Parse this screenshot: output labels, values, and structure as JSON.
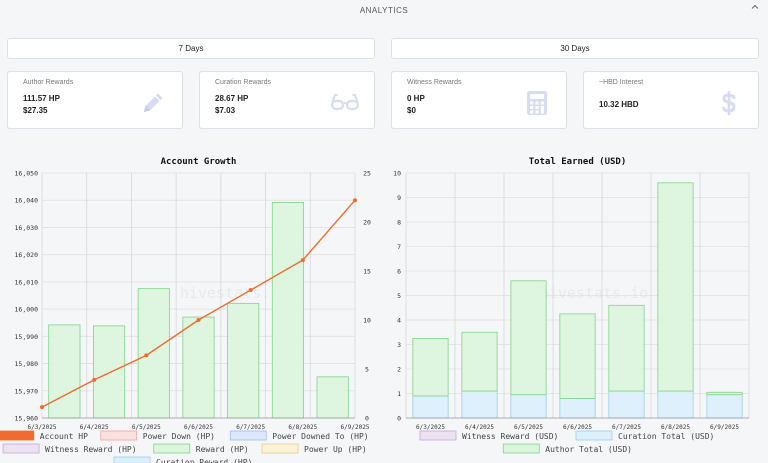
{
  "header": {
    "title": "ANALYTICS"
  },
  "range_buttons": [
    {
      "label": "7 Days"
    },
    {
      "label": "30 Days"
    }
  ],
  "cards": [
    {
      "label": "Author Rewards",
      "value_hp": "111.57 HP",
      "value_usd": "$27.35",
      "icon": "pencil-icon"
    },
    {
      "label": "Curation Rewards",
      "value_hp": "28.67 HP",
      "value_usd": "$7.03",
      "icon": "glasses-icon"
    },
    {
      "label": "Witness Rewards",
      "value_hp": "0 HP",
      "value_usd": "$0",
      "icon": "calculator-icon"
    },
    {
      "label": "~HBD Interest",
      "value_hp": "10.32 HBD",
      "value_usd": "",
      "icon": "dollar-icon"
    }
  ],
  "colors": {
    "accent_line": "#f26a2e",
    "reward_fill": "#dcf5dc",
    "reward_stroke": "#7fd38a",
    "curation_fill": "#dcf0fb",
    "card_icon": "#d8dcf0"
  },
  "watermark": "hivestats.io",
  "chart_data": [
    {
      "type": "bar",
      "title": "Account Growth",
      "categories": [
        "6/3/2025",
        "6/4/2025",
        "6/5/2025",
        "6/6/2025",
        "6/7/2025",
        "6/8/2025",
        "6/9/2025"
      ],
      "y_left": {
        "min": 15960,
        "max": 16050,
        "ticks": [
          "16,050",
          "16,040",
          "16,030",
          "16,020",
          "16,010",
          "16,000",
          "15,990",
          "15,980",
          "15,970",
          "15,960"
        ]
      },
      "y_right": {
        "min": 0,
        "max": 25,
        "ticks": [
          "25",
          "20",
          "15",
          "10",
          "5",
          "0"
        ]
      },
      "series": [
        {
          "name": "Account HP",
          "type": "line",
          "axis": "left",
          "values": [
            15964,
            15974,
            15983,
            15996,
            16007,
            16018,
            16040
          ]
        },
        {
          "name": "Power Down (HP)",
          "type": "bar",
          "axis": "right",
          "values": [
            0,
            0,
            0,
            0,
            0,
            0,
            0
          ]
        },
        {
          "name": "Power Downed To (HP)",
          "type": "bar",
          "axis": "right",
          "values": [
            0,
            0,
            0,
            0,
            0,
            0,
            0
          ]
        },
        {
          "name": "Witness Reward (HP)",
          "type": "bar",
          "axis": "right",
          "values": [
            0,
            0,
            0,
            0,
            0,
            0,
            0
          ]
        },
        {
          "name": "Reward (HP)",
          "type": "bar",
          "axis": "right",
          "values": [
            9.5,
            9.4,
            13.2,
            10.3,
            11.7,
            22.0,
            4.2
          ]
        },
        {
          "name": "Power Up (HP)",
          "type": "bar",
          "axis": "right",
          "values": [
            0,
            0,
            0,
            0,
            0,
            0,
            0
          ]
        },
        {
          "name": "Curation Reward (HP)",
          "type": "bar",
          "axis": "right",
          "values": [
            0,
            0,
            0,
            0,
            0,
            0,
            0
          ]
        }
      ],
      "legend": [
        {
          "name": "Account HP",
          "fill": "#f26a2e",
          "stroke": "#f26a2e"
        },
        {
          "name": "Power Down (HP)",
          "fill": "#fde0e0",
          "stroke": "#f4a0a0"
        },
        {
          "name": "Power Downed To (HP)",
          "fill": "#dbe8fb",
          "stroke": "#9dbcec"
        },
        {
          "name": "Witness Reward (HP)",
          "fill": "#ece2f2",
          "stroke": "#c3a8d6"
        },
        {
          "name": "Reward (HP)",
          "fill": "#dcf5dc",
          "stroke": "#7fd38a"
        },
        {
          "name": "Power Up (HP)",
          "fill": "#faf3d8",
          "stroke": "#e3cf8a"
        },
        {
          "name": "Curation Reward (HP)",
          "fill": "#dcf0fb",
          "stroke": "#9ccde8"
        }
      ],
      "grid": true,
      "legend_position": "bottom"
    },
    {
      "type": "bar",
      "stacked": true,
      "title": "Total Earned (USD)",
      "categories": [
        "6/3/2025",
        "6/4/2025",
        "6/5/2025",
        "6/6/2025",
        "6/7/2025",
        "6/8/2025",
        "6/9/2025"
      ],
      "y": {
        "min": 0,
        "max": 10,
        "ticks": [
          "10",
          "9",
          "8",
          "7",
          "6",
          "5",
          "4",
          "3",
          "2",
          "1",
          "0"
        ]
      },
      "series": [
        {
          "name": "Witness Reward (USD)",
          "values": [
            0,
            0,
            0,
            0,
            0,
            0,
            0
          ]
        },
        {
          "name": "Curation Total (USD)",
          "values": [
            0.9,
            1.1,
            0.95,
            0.8,
            1.1,
            1.1,
            0.95
          ]
        },
        {
          "name": "Author Total (USD)",
          "values": [
            2.35,
            2.4,
            4.65,
            3.45,
            3.5,
            8.5,
            0.1
          ]
        }
      ],
      "legend": [
        {
          "name": "Witness Reward (USD)",
          "fill": "#ece2f2",
          "stroke": "#c3a8d6"
        },
        {
          "name": "Curation Total (USD)",
          "fill": "#dcf0fb",
          "stroke": "#9ccde8"
        },
        {
          "name": "Author Total (USD)",
          "fill": "#dcf5dc",
          "stroke": "#7fd38a"
        }
      ],
      "grid": true,
      "legend_position": "bottom"
    }
  ]
}
